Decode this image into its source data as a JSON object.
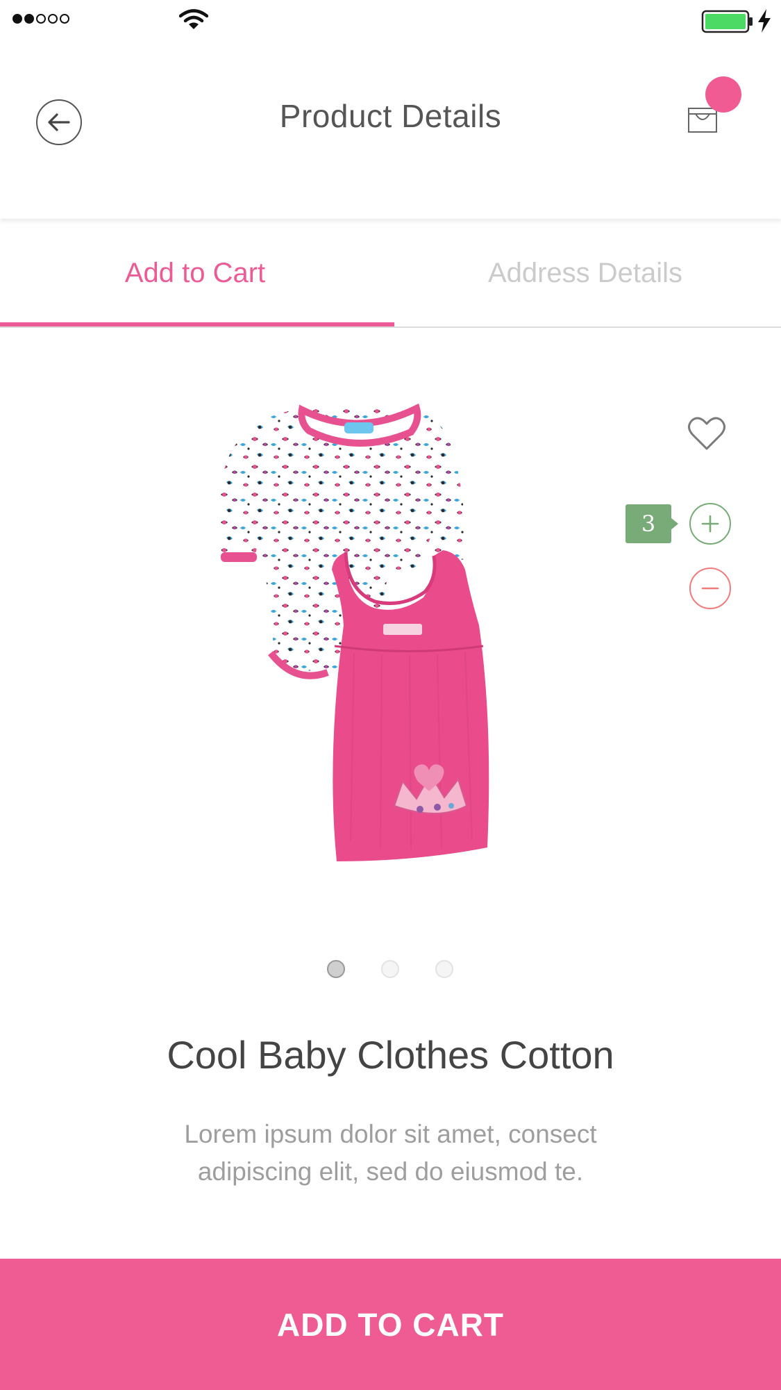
{
  "status_bar": {
    "signal_icon": "signal-dots-icon",
    "wifi_icon": "wifi-icon",
    "battery_icon": "battery-icon",
    "charging_icon": "charging-bolt-icon",
    "signal_strength": 2,
    "signal_max": 5
  },
  "header": {
    "title": "Product Details",
    "back_icon": "arrow-left-icon",
    "cart_icon": "shopping-bag-icon",
    "badge_color": "#ef5b92"
  },
  "tabs": [
    {
      "label": "Add to Cart",
      "active": true
    },
    {
      "label": "Address Details",
      "active": false
    }
  ],
  "product": {
    "name": "Cool Baby Clothes Cotton",
    "description": "Lorem ipsum dolor sit amet, consect adipiscing elit, sed do eiusmod te.",
    "image": "baby-outfit-image",
    "quantity": "3",
    "wishlist_icon": "heart-outline-icon",
    "plus_icon": "plus-circle-icon",
    "minus_icon": "minus-circle-icon"
  },
  "pager": {
    "pages": 3,
    "current": 1
  },
  "actions": {
    "add_to_cart": "ADD TO CART"
  },
  "colors": {
    "accent": "#ec5b95",
    "plus": "#78ab78",
    "minus": "#f37b7b",
    "battery": "#4cd964"
  }
}
